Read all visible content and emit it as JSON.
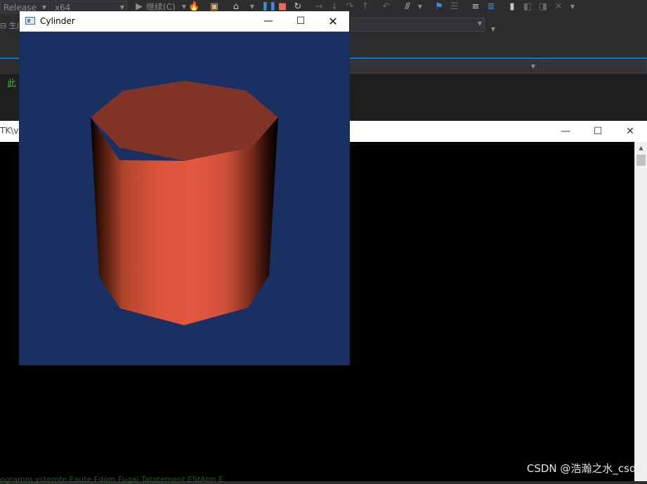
{
  "ide": {
    "config_combo": "Release",
    "platform_combo": "x64",
    "continue_label": "继续(C)",
    "build_label": "生成",
    "editor_fragment": "此",
    "console_path_fragment": "TK\\vt",
    "console_bottom_fragment": "ogramm ystemte Eaute Fdom Fugal Tatatement EStAtm E"
  },
  "vtk_window": {
    "title": "Cylinder",
    "background_color": "#1a3062",
    "object_color": "#e0553d"
  },
  "window_controls": {
    "minimize_icon": "minimize-icon",
    "maximize_icon": "maximize-icon",
    "close_icon": "close-icon"
  },
  "watermark": "CSDN @浩瀚之水_csdn"
}
